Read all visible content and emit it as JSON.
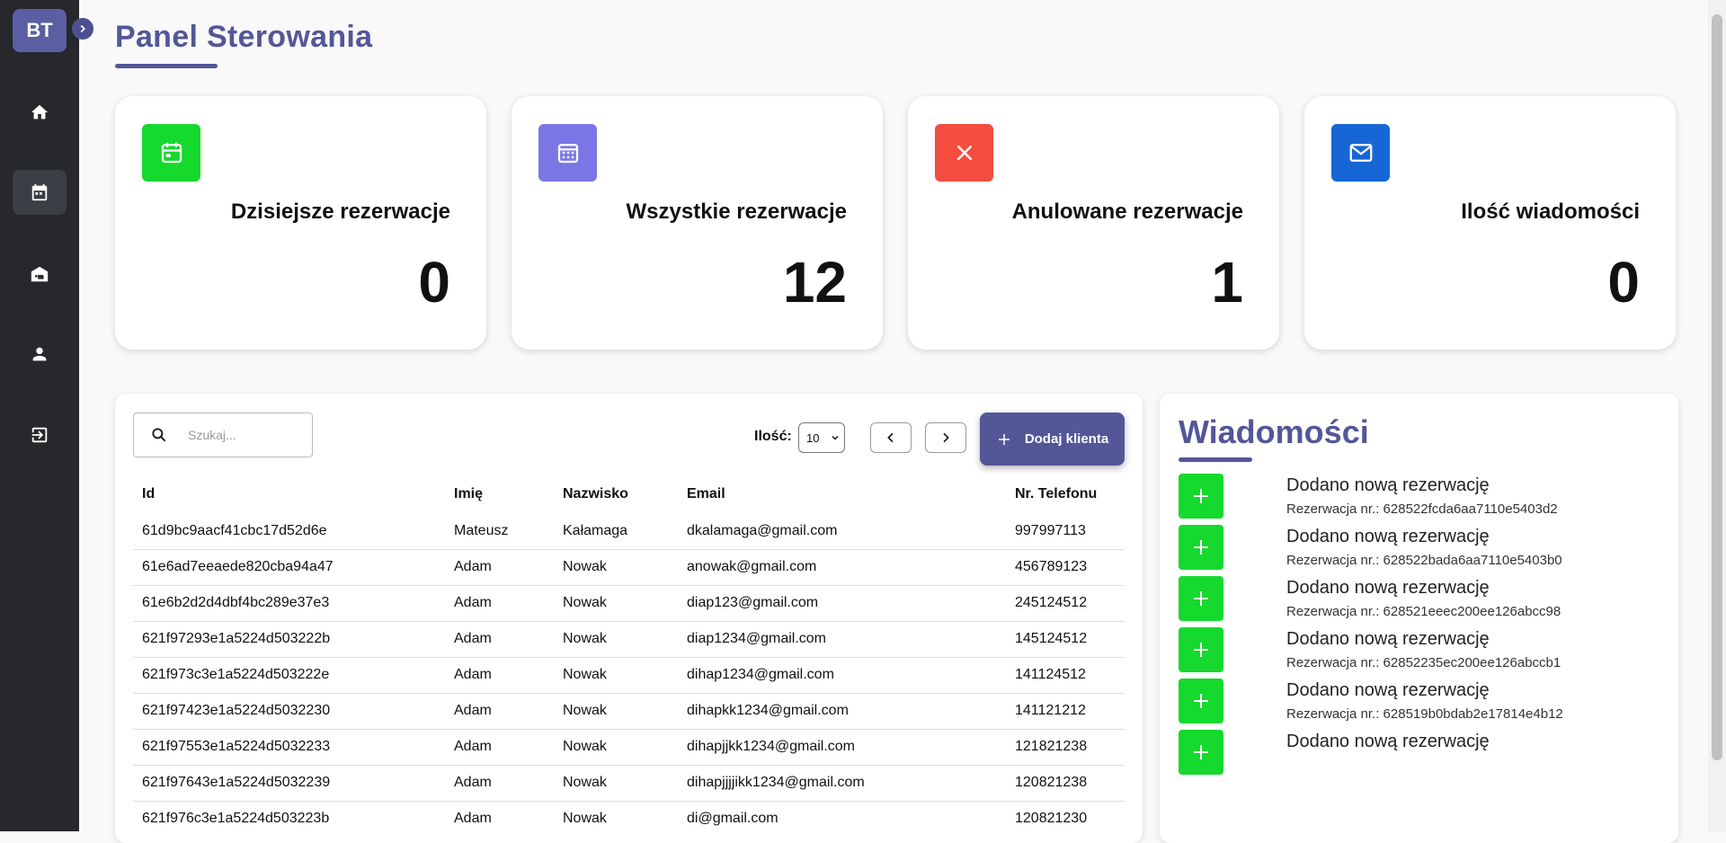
{
  "sidebar": {
    "logo": "BT",
    "items": [
      {
        "icon": "home-icon"
      },
      {
        "icon": "calendar-icon",
        "active": true
      },
      {
        "icon": "hotel-icon"
      },
      {
        "icon": "user-icon"
      },
      {
        "icon": "logout-icon"
      }
    ]
  },
  "page": {
    "title": "Panel Sterowania"
  },
  "stats": [
    {
      "label": "Dzisiejsze rezerwacje",
      "value": "0",
      "color": "#16d92e",
      "icon": "calendar-today-icon"
    },
    {
      "label": "Wszystkie rezerwacje",
      "value": "12",
      "color": "#7b76e6",
      "icon": "calendar-month-icon"
    },
    {
      "label": "Anulowane rezerwacje",
      "value": "1",
      "color": "#f44c3e",
      "icon": "close-icon"
    },
    {
      "label": "Ilość wiadomości",
      "value": "0",
      "color": "#1766d6",
      "icon": "mail-icon"
    }
  ],
  "clients": {
    "search_placeholder": "Szukaj...",
    "count_label": "Ilość:",
    "count_value": "10",
    "add_label": "Dodaj klienta",
    "columns": [
      "Id",
      "Imię",
      "Nazwisko",
      "Email",
      "Nr. Telefonu"
    ],
    "rows": [
      [
        "61d9bc9aacf41cbc17d52d6e",
        "Mateusz",
        "Kałamaga",
        "dkalamaga@gmail.com",
        "997997113"
      ],
      [
        "61e6ad7eeaede820cba94a47",
        "Adam",
        "Nowak",
        "anowak@gmail.com",
        "456789123"
      ],
      [
        "61e6b2d2d4dbf4bc289e37e3",
        "Adam",
        "Nowak",
        "diap123@gmail.com",
        "245124512"
      ],
      [
        "621f97293e1a5224d503222b",
        "Adam",
        "Nowak",
        "diap1234@gmail.com",
        "145124512"
      ],
      [
        "621f973c3e1a5224d503222e",
        "Adam",
        "Nowak",
        "dihap1234@gmail.com",
        "141124512"
      ],
      [
        "621f97423e1a5224d5032230",
        "Adam",
        "Nowak",
        "dihapkk1234@gmail.com",
        "141121212"
      ],
      [
        "621f97553e1a5224d5032233",
        "Adam",
        "Nowak",
        "dihapjjkk1234@gmail.com",
        "121821238"
      ],
      [
        "621f97643e1a5224d5032239",
        "Adam",
        "Nowak",
        "dihapjjjjikk1234@gmail.com",
        "120821238"
      ],
      [
        "621f976c3e1a5224d503223b",
        "Adam",
        "Nowak",
        "di@gmail.com",
        "120821230"
      ]
    ]
  },
  "messages": {
    "title": "Wiadomości",
    "items": [
      {
        "head": "Dodano nową rezerwację",
        "sub": "Rezerwacja nr.: 628522fcda6aa7110e5403d2"
      },
      {
        "head": "Dodano nową rezerwację",
        "sub": "Rezerwacja nr.: 628522bada6aa7110e5403b0"
      },
      {
        "head": "Dodano nową rezerwację",
        "sub": "Rezerwacja nr.: 628521eeec200ee126abcc98"
      },
      {
        "head": "Dodano nową rezerwację",
        "sub": "Rezerwacja nr.: 62852235ec200ee126abccb1"
      },
      {
        "head": "Dodano nową rezerwację",
        "sub": "Rezerwacja nr.: 628519b0bdab2e17814e4b12"
      },
      {
        "head": "Dodano nową rezerwację",
        "sub": ""
      }
    ]
  }
}
